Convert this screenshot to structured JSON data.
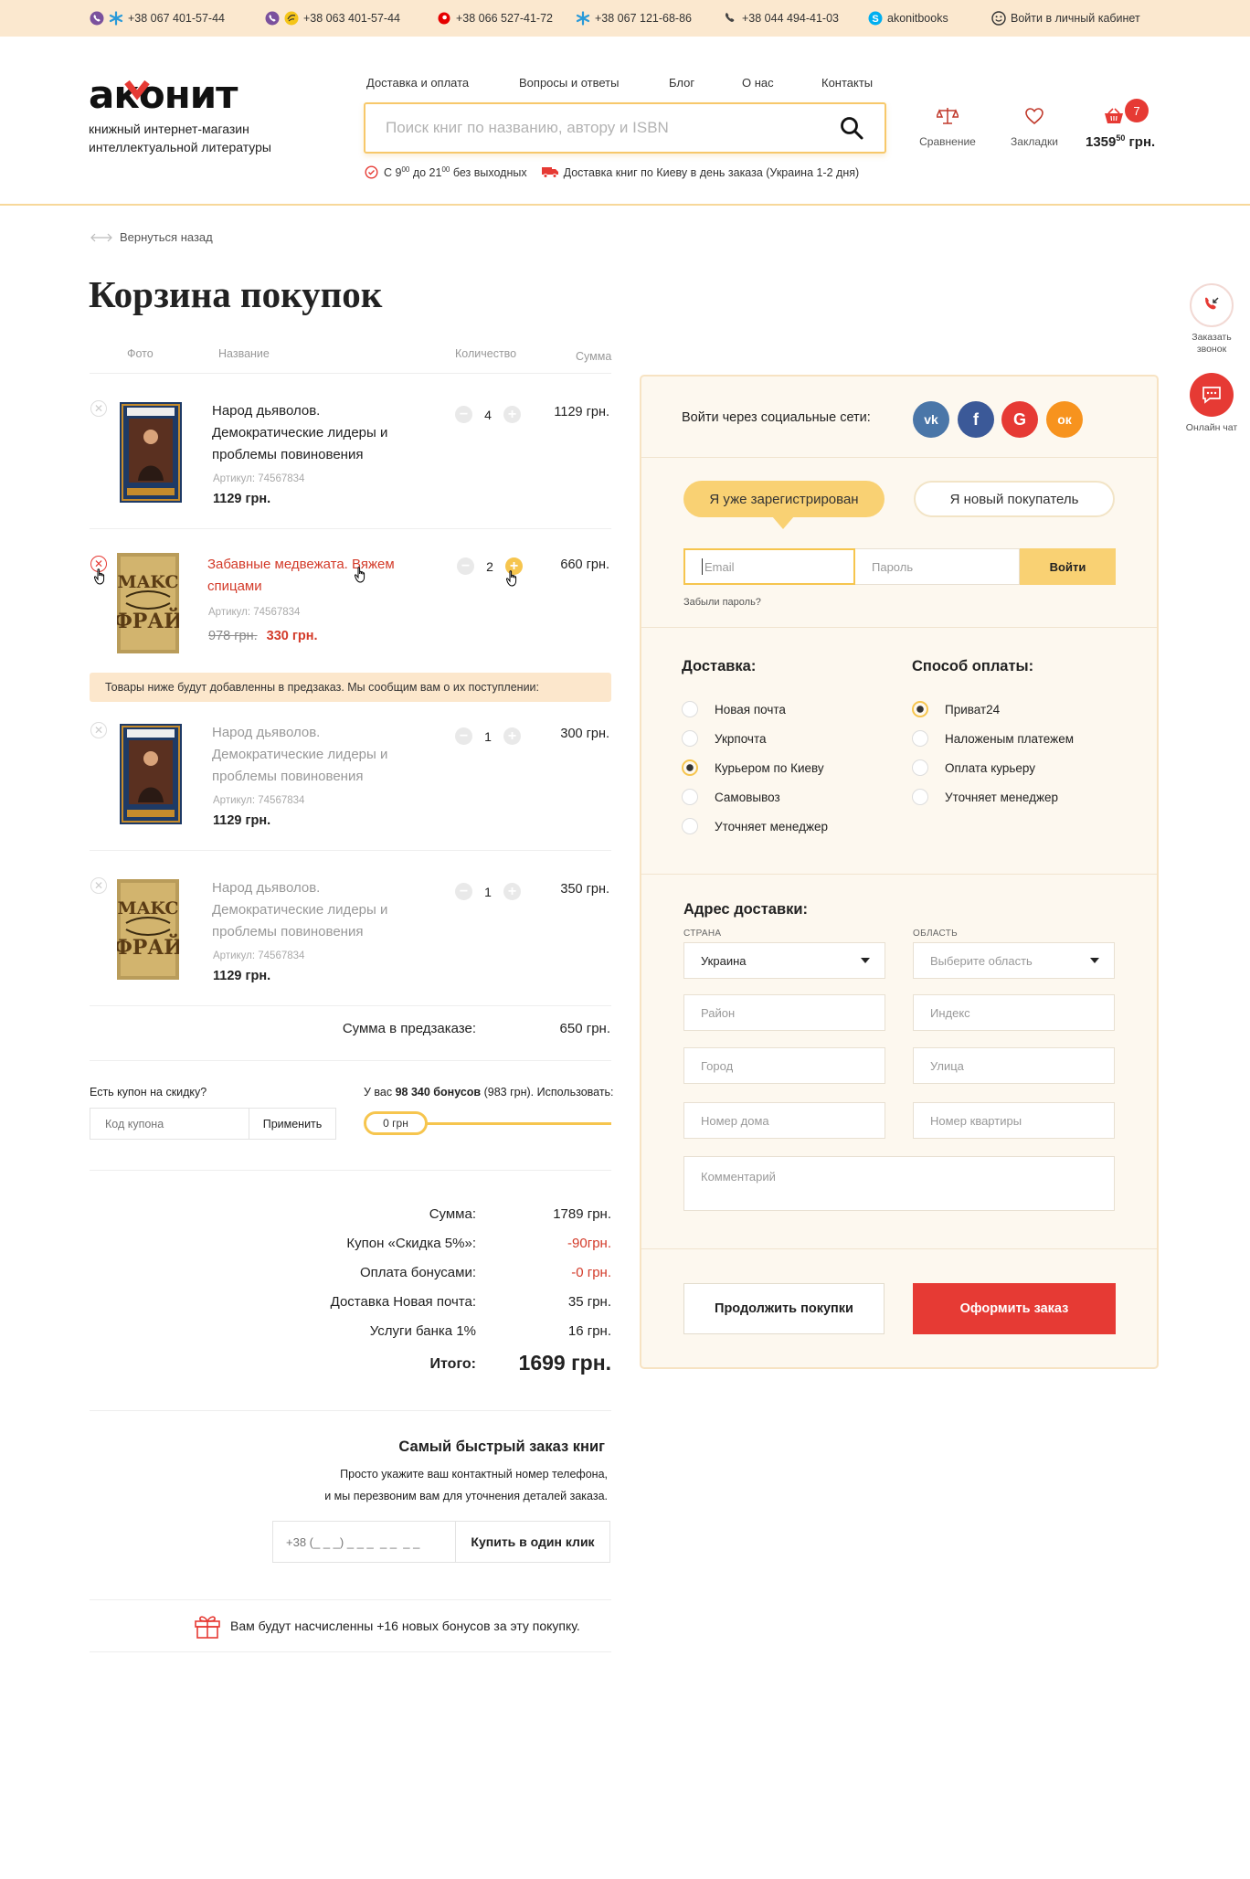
{
  "topbar": {
    "phones": [
      "+38 067 401-57-44",
      "+38 063 401-57-44",
      "+38 066 527-41-72",
      "+38 067 121-68-86",
      "+38 044 494-41-03"
    ],
    "skype": "akonitbooks",
    "account": "Войти в личный кабинет"
  },
  "header": {
    "logo_text": "аконит",
    "logo_sub1": "книжный интернет-магазин",
    "logo_sub2": "интеллектуальной литературы",
    "nav": [
      "Доставка и оплата",
      "Вопросы и ответы",
      "Блог",
      "О нас",
      "Контакты"
    ],
    "search_placeholder": "Поиск книг по названию, автору и ISBN",
    "hours_prefix": "С 9",
    "hours_sup1": "00",
    "hours_mid": " до 21",
    "hours_sup2": "00",
    "hours_suffix": " без выходных",
    "delivery_note": "Доставка книг по Киеву в день заказа (Украина 1-2 дня)",
    "compare_label": "Сравнение",
    "bookmarks_label": "Закладки",
    "cart_count": "7",
    "cart_total": "1359",
    "cart_total_cents": "50",
    "cart_currency": " грн."
  },
  "back_link": "Вернуться назад",
  "page_title": "Корзина покупок",
  "columns": {
    "photo": "Фото",
    "name": "Название",
    "qty": "Количество",
    "sum": "Сумма"
  },
  "items": [
    {
      "title_lines": [
        "Народ дьяволов.",
        "Демократические лидеры и",
        "проблемы повиновения"
      ],
      "article": "Артикул: 74567834",
      "price": "1129 грн.",
      "qty": "4",
      "sum": "1129 грн."
    },
    {
      "title_lines": [
        "Забавные медвежата. Вяжем",
        "спицами"
      ],
      "article": "Артикул: 74567834",
      "old_price": "978 грн.",
      "price": "330 грн.",
      "qty": "2",
      "sum": "660 грн."
    }
  ],
  "preorder_notice": "Товары ниже будут добавленны в предзаказ. Мы сообщим вам о их поступлении:",
  "preorder_items": [
    {
      "title_lines": [
        "Народ дьяволов.",
        "Демократические лидеры и",
        "проблемы повиновения"
      ],
      "article": "Артикул: 74567834",
      "price": "1129 грн.",
      "qty": "1",
      "sum": "300 грн."
    },
    {
      "title_lines": [
        "Народ дьяволов.",
        "Демократические лидеры и",
        "проблемы повиновения"
      ],
      "article": "Артикул: 74567834",
      "price": "1129 грн.",
      "qty": "1",
      "sum": "350 грн."
    }
  ],
  "preorder_sum_label": "Сумма в предзаказе:",
  "preorder_sum": "650 грн.",
  "coupon": {
    "label": "Есть купон на скидку?",
    "placeholder": "Код купона",
    "apply": "Применить"
  },
  "bonus": {
    "prefix": "У вас ",
    "amount": "98 340 бонусов",
    "suffix": " (983 грн). Использовать:",
    "value": "0 грн"
  },
  "totals": [
    {
      "label": "Сумма:",
      "value": "1789 грн.",
      "red": false
    },
    {
      "label": "Купон «Скидка 5%»:",
      "value": "-90грн.",
      "red": true
    },
    {
      "label": "Оплата бонусами:",
      "value": "-0 грн.",
      "red": true
    },
    {
      "label": "Доставка Новая почта:",
      "value": "35 грн.",
      "red": false
    },
    {
      "label": "Услуги банка 1%",
      "value": "16 грн.",
      "red": false
    }
  ],
  "grand_total_label": "Итого:",
  "grand_total": "1699 грн.",
  "quick_order": {
    "title": "Самый быстрый заказ книг",
    "line1": "Просто укажите ваш контактный номер телефона,",
    "line2": "и мы перезвоним вам для уточнения деталей заказа.",
    "phone_placeholder": "+38 (_ _ _) _ _ _  _ _  _ _",
    "button": "Купить в один клик"
  },
  "bonus_note": "Вам будут насчисленны +16 новых бонусов за эту покупку.",
  "panel": {
    "social_label": "Войти через социальные сети:",
    "social": [
      {
        "name": "vk",
        "glyph": "vk",
        "color": "#4a76a8"
      },
      {
        "name": "facebook",
        "glyph": "f",
        "color": "#3b5998"
      },
      {
        "name": "google",
        "glyph": "G",
        "color": "#e63a34"
      },
      {
        "name": "odnoklassniki",
        "glyph": "ок",
        "color": "#f7931e"
      }
    ],
    "tab_registered": "Я уже зарегистрирован",
    "tab_new": "Я новый покупатель",
    "email_placeholder": "Email",
    "password_placeholder": "Пароль",
    "login": "Войти",
    "forgot": "Забыли пароль?",
    "delivery_title": "Доставка:",
    "delivery_options": [
      {
        "label": "Новая почта",
        "checked": false
      },
      {
        "label": "Укрпочта",
        "checked": false
      },
      {
        "label": "Курьером по Киеву",
        "checked": true
      },
      {
        "label": "Самовывоз",
        "checked": false
      },
      {
        "label": "Уточняет менеджер",
        "checked": false
      }
    ],
    "payment_title": "Способ оплаты:",
    "payment_options": [
      {
        "label": "Приват24",
        "checked": true
      },
      {
        "label": "Наложеным платежем",
        "checked": false
      },
      {
        "label": "Оплата курьеру",
        "checked": false
      },
      {
        "label": "Уточняет менеджер",
        "checked": false
      }
    ],
    "address_title": "Адрес доставки:",
    "country_label": "СТРАНА",
    "country_value": "Украина",
    "region_label": "ОБЛАСТЬ",
    "region_placeholder": "Выберите область",
    "district": "Район",
    "zip": "Индекс",
    "city": "Город",
    "street": "Улица",
    "house": "Номер дома",
    "apartment": "Номер квартиры",
    "comment": "Комментарий",
    "continue": "Продолжить покупки",
    "checkout": "Оформить заказ"
  },
  "side": {
    "callback": "Заказать звонок",
    "chat": "Онлайн чат"
  },
  "colors": {
    "accent": "#f6c54e",
    "red": "#e63a34",
    "topbar": "#fbe8cf",
    "panel": "#fdf8ef"
  }
}
